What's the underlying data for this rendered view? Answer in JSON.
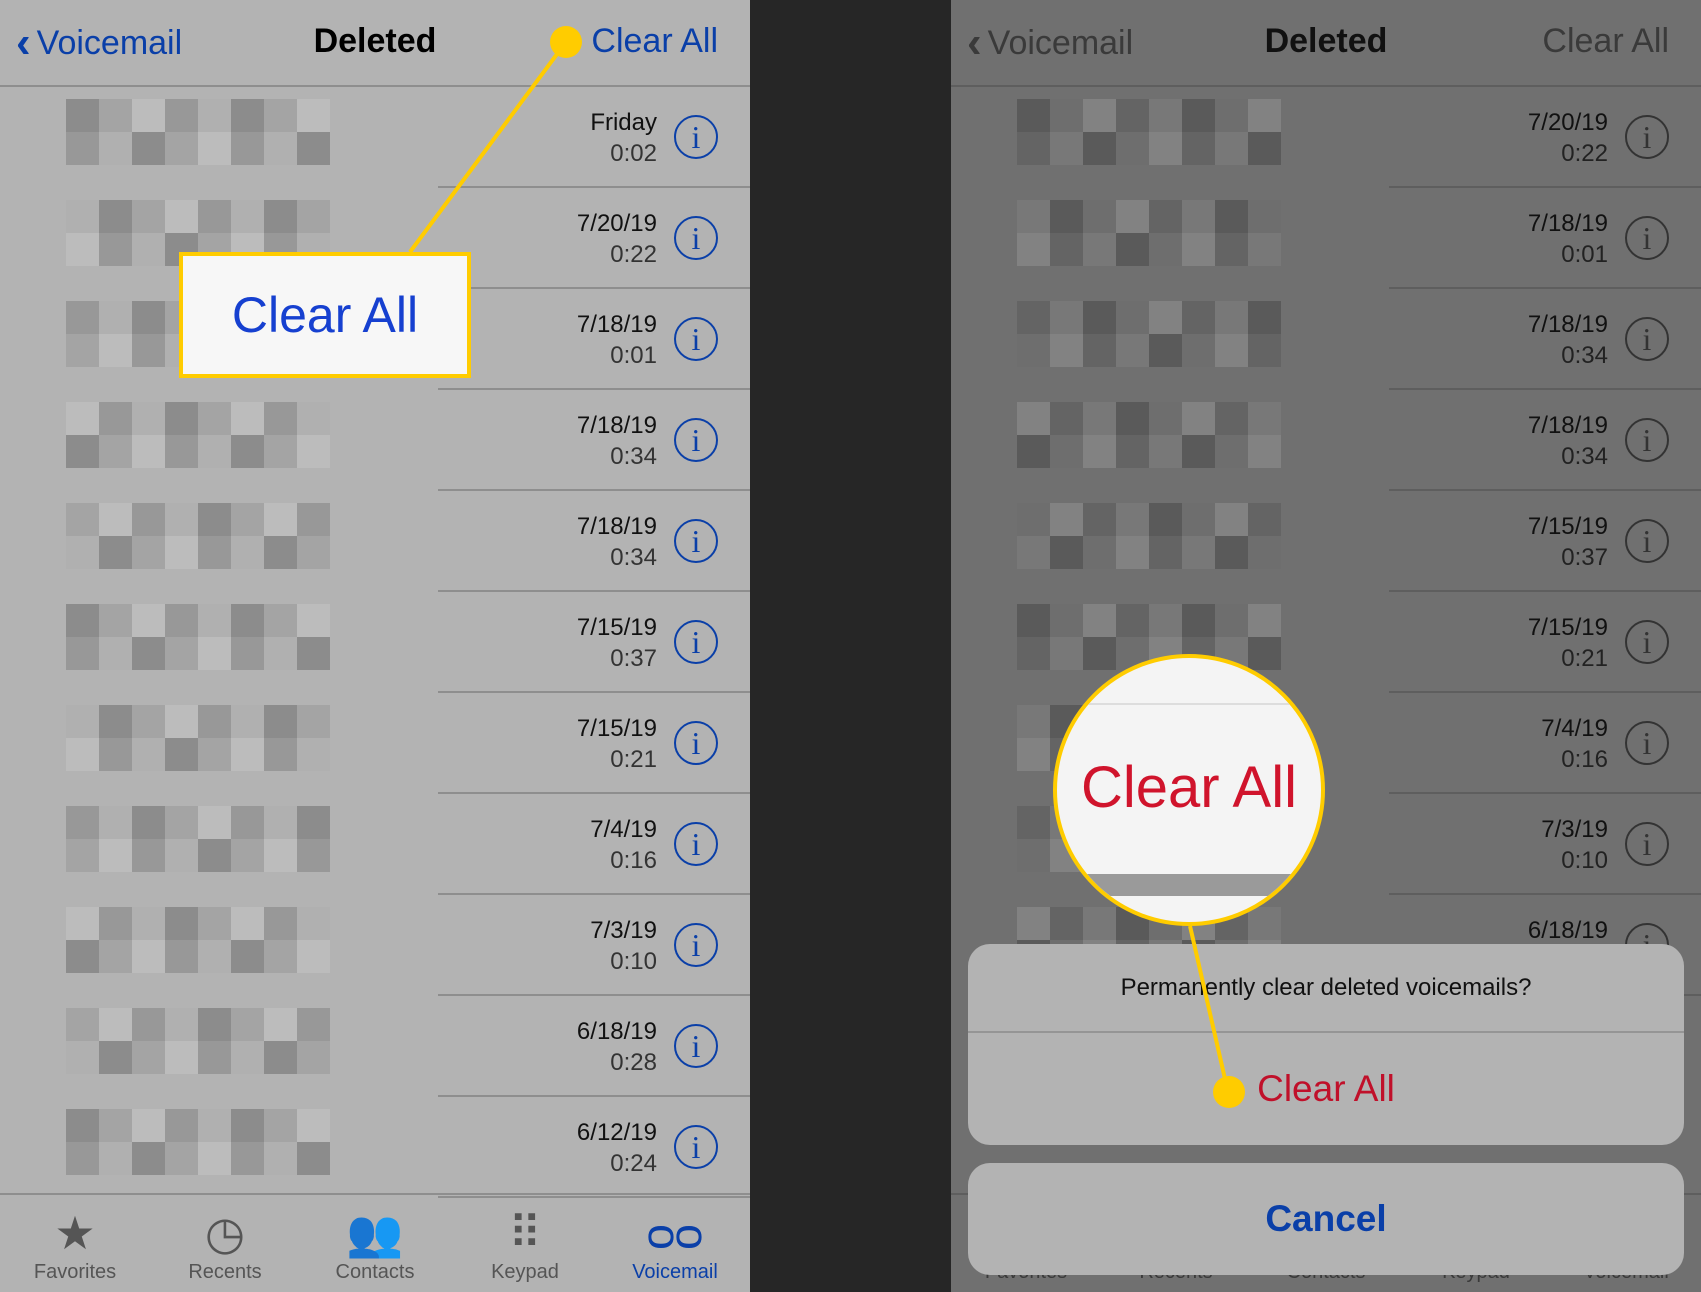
{
  "left": {
    "header": {
      "back_label": "Voicemail",
      "title": "Deleted",
      "clear_all": "Clear All"
    },
    "rows": [
      {
        "date": "Friday",
        "duration": "0:02"
      },
      {
        "date": "7/20/19",
        "duration": "0:22"
      },
      {
        "date": "7/18/19",
        "duration": "0:01"
      },
      {
        "date": "7/18/19",
        "duration": "0:34"
      },
      {
        "date": "7/18/19",
        "duration": "0:34"
      },
      {
        "date": "7/15/19",
        "duration": "0:37"
      },
      {
        "date": "7/15/19",
        "duration": "0:21"
      },
      {
        "date": "7/4/19",
        "duration": "0:16"
      },
      {
        "date": "7/3/19",
        "duration": "0:10"
      },
      {
        "date": "6/18/19",
        "duration": "0:28"
      },
      {
        "date": "6/12/19",
        "duration": "0:24"
      }
    ],
    "tabs": [
      {
        "label": "Favorites",
        "icon": "star-icon"
      },
      {
        "label": "Recents",
        "icon": "clock-icon"
      },
      {
        "label": "Contacts",
        "icon": "contacts-icon"
      },
      {
        "label": "Keypad",
        "icon": "keypad-icon"
      },
      {
        "label": "Voicemail",
        "icon": "voicemail-icon",
        "active": true
      }
    ],
    "callout": "Clear All"
  },
  "right": {
    "header": {
      "back_label": "Voicemail",
      "title": "Deleted",
      "clear_all": "Clear All"
    },
    "rows": [
      {
        "date": "7/20/19",
        "duration": "0:22"
      },
      {
        "date": "7/18/19",
        "duration": "0:01"
      },
      {
        "date": "7/18/19",
        "duration": "0:34"
      },
      {
        "date": "7/18/19",
        "duration": "0:34"
      },
      {
        "date": "7/15/19",
        "duration": "0:37"
      },
      {
        "date": "7/15/19",
        "duration": "0:21"
      },
      {
        "date": "7/4/19",
        "duration": "0:16"
      },
      {
        "date": "7/3/19",
        "duration": "0:10"
      },
      {
        "date": "6/18/19",
        "duration": ""
      }
    ],
    "tabs": [
      {
        "label": "Favorites"
      },
      {
        "label": "Recents"
      },
      {
        "label": "Contacts"
      },
      {
        "label": "Keypad"
      },
      {
        "label": "Voicemail"
      }
    ],
    "sheet": {
      "message": "Permanently clear deleted voicemails?",
      "clear_all": "Clear All",
      "cancel": "Cancel"
    },
    "magnifier": "Clear All"
  },
  "colors": {
    "blue": "#0a3fa8",
    "red": "#c0102a",
    "callout_yellow": "#ffcc00",
    "destructive_red": "#d0142c"
  }
}
